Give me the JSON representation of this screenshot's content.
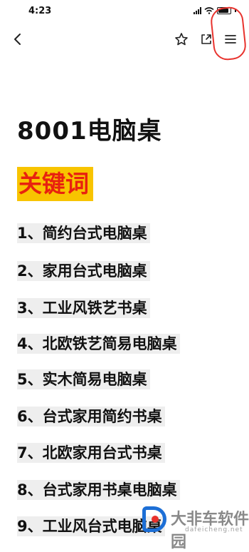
{
  "status_bar": {
    "time": "4:23"
  },
  "nav": {
    "back_icon": "chevron-left-icon",
    "favorite_icon": "star-icon",
    "share_icon": "share-icon",
    "menu_icon": "menu-icon",
    "highlight_color": "#e8322d"
  },
  "article": {
    "title": "8001电脑桌",
    "keyword_heading": "关键词",
    "keyword_heading_bg": "#f8c400",
    "keyword_heading_color": "#e8210f",
    "keywords": [
      "1、简约台式电脑桌",
      "2、家用台式电脑桌",
      "3、工业风铁艺书桌",
      "4、北欧铁艺简易电脑桌",
      "5、实木简易电脑桌",
      "6、台式家用简约书桌",
      "7、北欧家用台式书桌",
      "8、台式家用书桌电脑桌",
      "9、工业风台式电脑桌"
    ]
  },
  "watermark": {
    "text": "大非车软件园",
    "url": "dafeicheng.net"
  }
}
